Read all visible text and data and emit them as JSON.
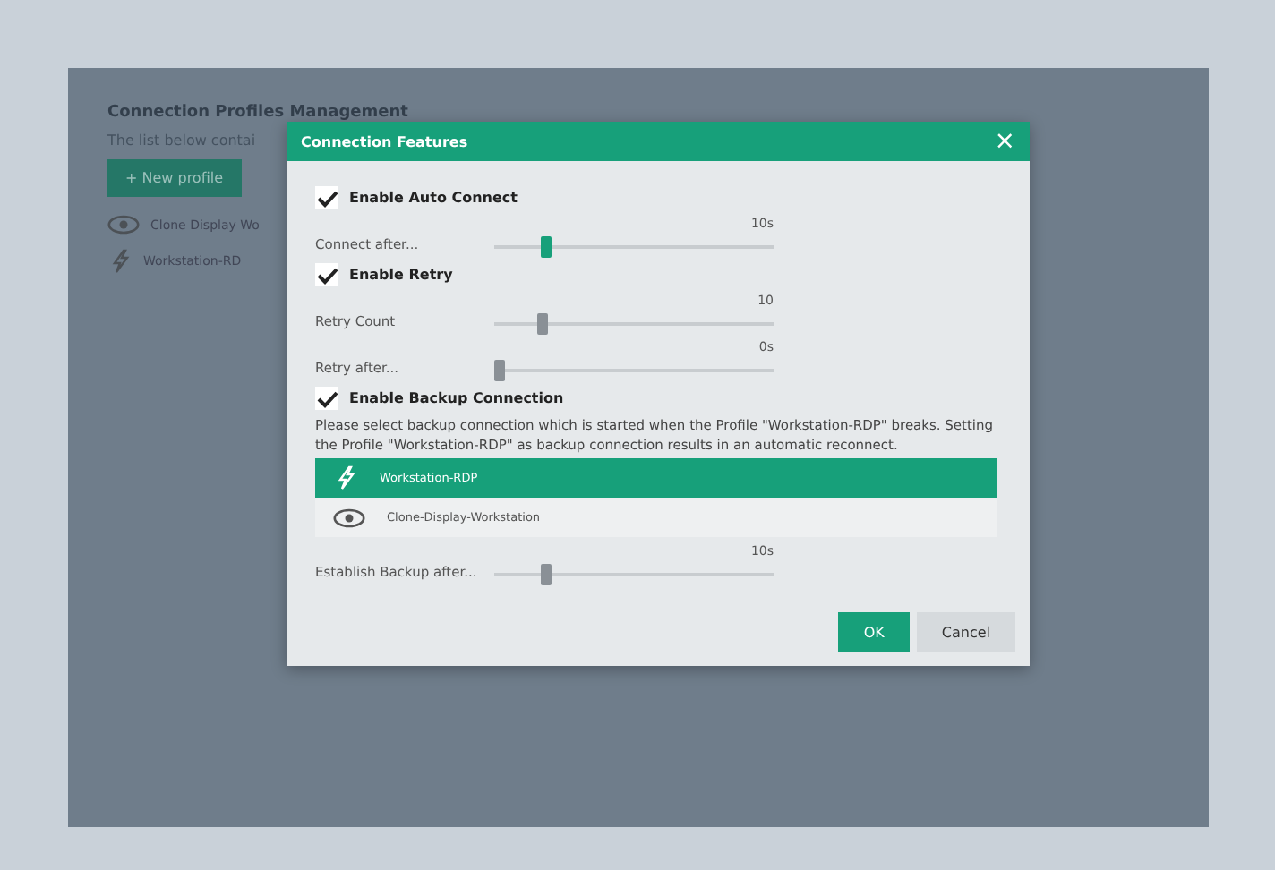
{
  "background_app": {
    "title": "Connection Profiles Management",
    "description": "The list below contai",
    "new_profile_button": "+ New profile",
    "profiles": [
      {
        "kind": "eye",
        "label": "Clone Display Wo"
      },
      {
        "kind": "plug",
        "label": "Workstation-RD"
      }
    ]
  },
  "dialog": {
    "title": "Connection Features",
    "close": "×",
    "sections": [
      {
        "label": "Enable Auto Connect",
        "checked": true,
        "sliders": [
          {
            "label": "Connect after...",
            "reading": "10s",
            "level": 0.17,
            "focused": true
          }
        ]
      },
      {
        "label": "Enable Retry",
        "checked": true,
        "sliders": [
          {
            "label": "Retry Count",
            "reading": "10",
            "level": 0.16,
            "focused": false
          },
          {
            "label": "Retry after...",
            "reading": "0s",
            "level": 0,
            "focused": false
          }
        ]
      },
      {
        "label": "Enable Backup Connection",
        "checked": true,
        "description": "Please select backup connection which is started when the Profile \"Workstation-RDP\" breaks. Setting the Profile \"Workstation-RDP\" as backup connection results in an automatic reconnect.",
        "options": [
          {
            "kind": "plug",
            "label": "Workstation-RDP",
            "selected": true
          },
          {
            "kind": "eye",
            "label": "Clone-Display-Workstation",
            "selected": false
          }
        ],
        "sliders": [
          {
            "label": "Establish Backup after...",
            "reading": "10s",
            "level": 0.17,
            "focused": false
          }
        ]
      }
    ],
    "buttons": [
      {
        "label": "OK",
        "kind": "primary"
      },
      {
        "label": "Cancel",
        "kind": "secondary"
      }
    ]
  }
}
